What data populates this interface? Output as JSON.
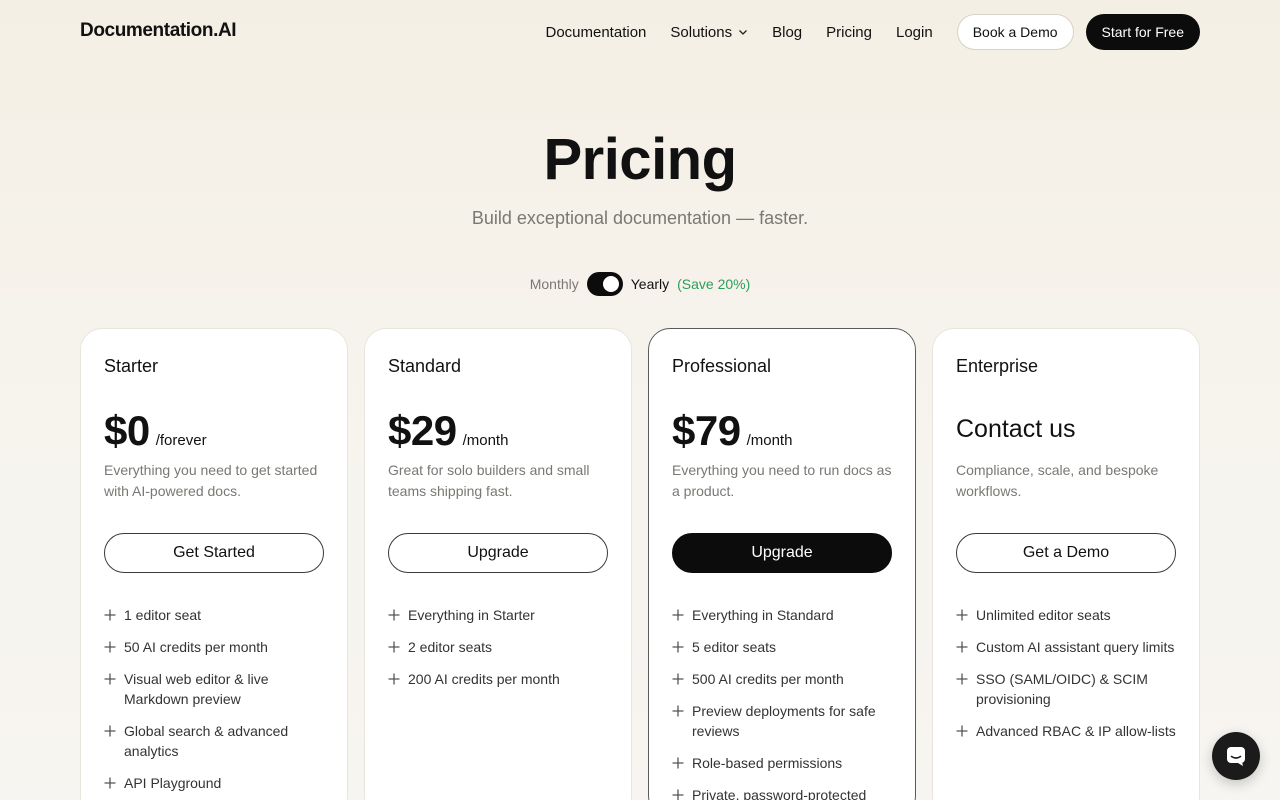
{
  "nav": {
    "logo": "Documentation.AI",
    "links": {
      "documentation": "Documentation",
      "solutions": "Solutions",
      "blog": "Blog",
      "pricing": "Pricing",
      "login": "Login"
    },
    "book_demo": "Book a Demo",
    "start_free": "Start for Free"
  },
  "hero": {
    "title": "Pricing",
    "subtitle": "Build exceptional documentation — faster."
  },
  "billing": {
    "monthly": "Monthly",
    "yearly": "Yearly",
    "save": "(Save 20%)",
    "selected": "Yearly"
  },
  "plans": [
    {
      "name": "Starter",
      "price": "$0",
      "period": "/forever",
      "description": "Everything you need to get started with AI-powered docs.",
      "button": "Get Started",
      "features": [
        "1 editor seat",
        "50 AI credits per month",
        "Visual web editor & live Markdown preview",
        "Global search & advanced analytics",
        "API Playground"
      ]
    },
    {
      "name": "Standard",
      "price": "$29",
      "period": "/month",
      "description": "Great for solo builders and small teams shipping fast.",
      "button": "Upgrade",
      "features": [
        "Everything in Starter",
        "2 editor seats",
        "200 AI credits per month"
      ]
    },
    {
      "name": "Professional",
      "price": "$79",
      "period": "/month",
      "description": "Everything you need to run docs as a product.",
      "button": "Upgrade",
      "features": [
        "Everything in Standard",
        "5 editor seats",
        "500 AI credits per month",
        "Preview deployments for safe reviews",
        "Role-based permissions",
        "Private, password-protected"
      ]
    },
    {
      "name": "Enterprise",
      "contact": "Contact us",
      "description": "Compliance, scale, and bespoke workflows.",
      "button": "Get a Demo",
      "features": [
        "Unlimited editor seats",
        "Custom AI assistant query limits",
        "SSO (SAML/OIDC) & SCIM provisioning",
        "Advanced RBAC & IP allow-lists"
      ]
    }
  ],
  "icons": {
    "chat": "chat-bubble-icon",
    "plus": "plus-icon",
    "chevron": "chevron-down-icon"
  },
  "colors": {
    "accent_dark": "#0c0c0c",
    "save_green": "#2e9d5b",
    "muted_text": "#7a7873"
  }
}
